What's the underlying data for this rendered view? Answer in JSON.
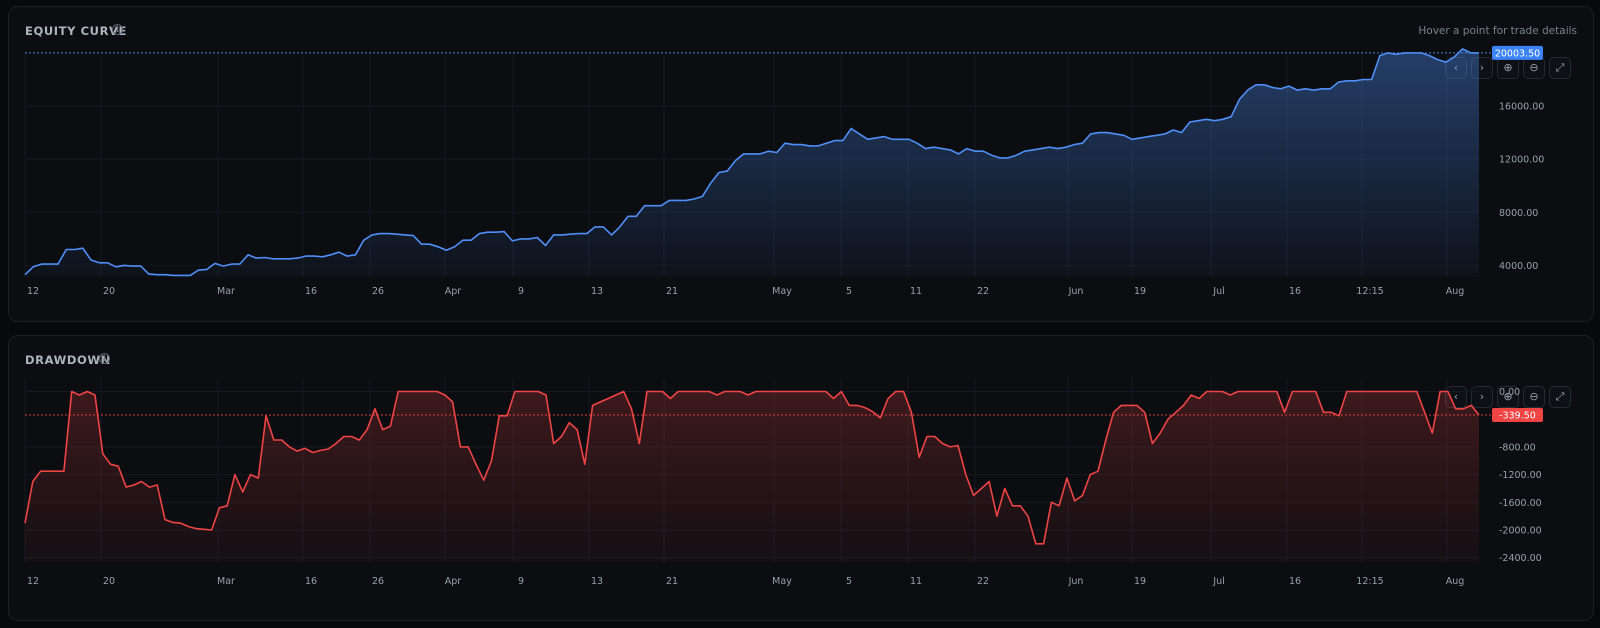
{
  "colors": {
    "equity_line": "#4f8ff7",
    "equity_label_bg": "#3b82f6",
    "drawdown_line": "#ef4444",
    "drawdown_label_bg": "#ef4444",
    "grid": "#151922",
    "background": "#0b0d11"
  },
  "hint": "Hover a point for trade details",
  "toolbar_icons": [
    "chevron-left-icon",
    "chevron-right-icon",
    "zoom-in-icon",
    "zoom-out-icon",
    "expand-icon"
  ],
  "x_ticks": [
    "12",
    "20",
    "Mar",
    "16",
    "26",
    "Apr",
    "9",
    "13",
    "21",
    "May",
    "5",
    "11",
    "22",
    "Jun",
    "19",
    "Jul",
    "16",
    "12:15",
    "Aug"
  ],
  "chart_data": [
    {
      "type": "area",
      "title": "EQUITY CURVE",
      "ylim": [
        2000,
        21500
      ],
      "y_ticks": [
        "4000.00",
        "8000.00",
        "12000.00",
        "16000.00"
      ],
      "last_value_label": "20003.50",
      "last_value": 20003.5,
      "grid": true,
      "series": [
        {
          "values": [
            3300,
            3900,
            4100,
            4100,
            4100,
            5200,
            5200,
            5300,
            4400,
            4200,
            4200,
            3900,
            4000,
            3950,
            3950,
            3350,
            3300,
            3300,
            3250,
            3250,
            3250,
            3650,
            3700,
            4150,
            3950,
            4100,
            4100,
            4800,
            4550,
            4600,
            4500,
            4500,
            4500,
            4550,
            4700,
            4700,
            4650,
            4800,
            5000,
            4700,
            4800,
            5900,
            6300,
            6400,
            6400,
            6350,
            6300,
            6250,
            5600,
            5600,
            5400,
            5150,
            5400,
            5900,
            5900,
            6400,
            6500,
            6500,
            6550,
            5850,
            6000,
            6000,
            6100,
            5500,
            6300,
            6300,
            6350,
            6400,
            6400,
            6900,
            6900,
            6300,
            6900,
            7700,
            7700,
            8500,
            8500,
            8500,
            8900,
            8900,
            8900,
            9000,
            9200,
            10200,
            11000,
            11100,
            11900,
            12400,
            12400,
            12400,
            12600,
            12500,
            13200,
            13100,
            13100,
            13000,
            13000,
            13200,
            13400,
            13400,
            14300,
            13900,
            13500,
            13600,
            13700,
            13500,
            13500,
            13500,
            13200,
            12800,
            12900,
            12800,
            12700,
            12400,
            12800,
            12600,
            12600,
            12300,
            12100,
            12100,
            12300,
            12600,
            12700,
            12800,
            12900,
            12800,
            12900,
            13100,
            13200,
            13900,
            14000,
            14000,
            13900,
            13800,
            13500,
            13600,
            13700,
            13800,
            13900,
            14200,
            14000,
            14800,
            14900,
            15000,
            14900,
            15000,
            15200,
            16500,
            17200,
            17600,
            17600,
            17400,
            17300,
            17500,
            17200,
            17300,
            17200,
            17300,
            17300,
            17800,
            17900,
            17900,
            18000,
            18000,
            19800,
            20000,
            19900,
            20000,
            20000,
            20000,
            19800,
            19500,
            19300,
            19700,
            20300,
            20000,
            20003.5
          ]
        }
      ]
    },
    {
      "type": "area",
      "title": "DRAWDOWN",
      "ylim": [
        -2520,
        80
      ],
      "y_ticks": [
        "0.00",
        "-800.00",
        "-1200.00",
        "-1600.00",
        "-2000.00",
        "-2400.00"
      ],
      "last_value_label": "-339.50",
      "last_value": -339.5,
      "grid": true,
      "series": [
        {
          "values": [
            -1900,
            -1300,
            -1150,
            -1150,
            -1150,
            -1150,
            0,
            -50,
            0,
            -50,
            -900,
            -1050,
            -1080,
            -1380,
            -1350,
            -1300,
            -1380,
            -1350,
            -1850,
            -1890,
            -1900,
            -1950,
            -1980,
            -1990,
            -2000,
            -1680,
            -1650,
            -1200,
            -1450,
            -1200,
            -1250,
            -350,
            -700,
            -700,
            -800,
            -860,
            -820,
            -880,
            -850,
            -830,
            -750,
            -650,
            -650,
            -700,
            -550,
            -250,
            -550,
            -500,
            0,
            0,
            0,
            0,
            0,
            0,
            -50,
            -150,
            -800,
            -800,
            -1050,
            -1280,
            -1000,
            -350,
            -350,
            0,
            0,
            0,
            0,
            -50,
            -750,
            -650,
            -450,
            -550,
            -1050,
            -200,
            -150,
            -100,
            -50,
            0,
            -250,
            -750,
            0,
            0,
            0,
            -100,
            0,
            0,
            0,
            0,
            0,
            -50,
            0,
            0,
            0,
            -50,
            0,
            0,
            0,
            0,
            0,
            0,
            0,
            0,
            0,
            0,
            -100,
            0,
            -200,
            -200,
            -230,
            -290,
            -380,
            -100,
            0,
            0,
            -300,
            -950,
            -650,
            -650,
            -750,
            -800,
            -780,
            -1200,
            -1500,
            -1400,
            -1300,
            -1800,
            -1400,
            -1650,
            -1650,
            -1800,
            -2200,
            -2200,
            -1600,
            -1650,
            -1250,
            -1580,
            -1500,
            -1200,
            -1150,
            -700,
            -300,
            -200,
            -200,
            -200,
            -300,
            -750,
            -600,
            -400,
            -300,
            -200,
            -50,
            -100,
            0,
            0,
            0,
            -50,
            0,
            0,
            0,
            0,
            0,
            0,
            -300,
            0,
            0,
            0,
            0,
            -300,
            -300,
            -350,
            0,
            0,
            0,
            0,
            0,
            0,
            0,
            0,
            0,
            0,
            -300,
            -600,
            0,
            0,
            -250,
            -250,
            -200,
            -339.5
          ]
        }
      ]
    }
  ]
}
